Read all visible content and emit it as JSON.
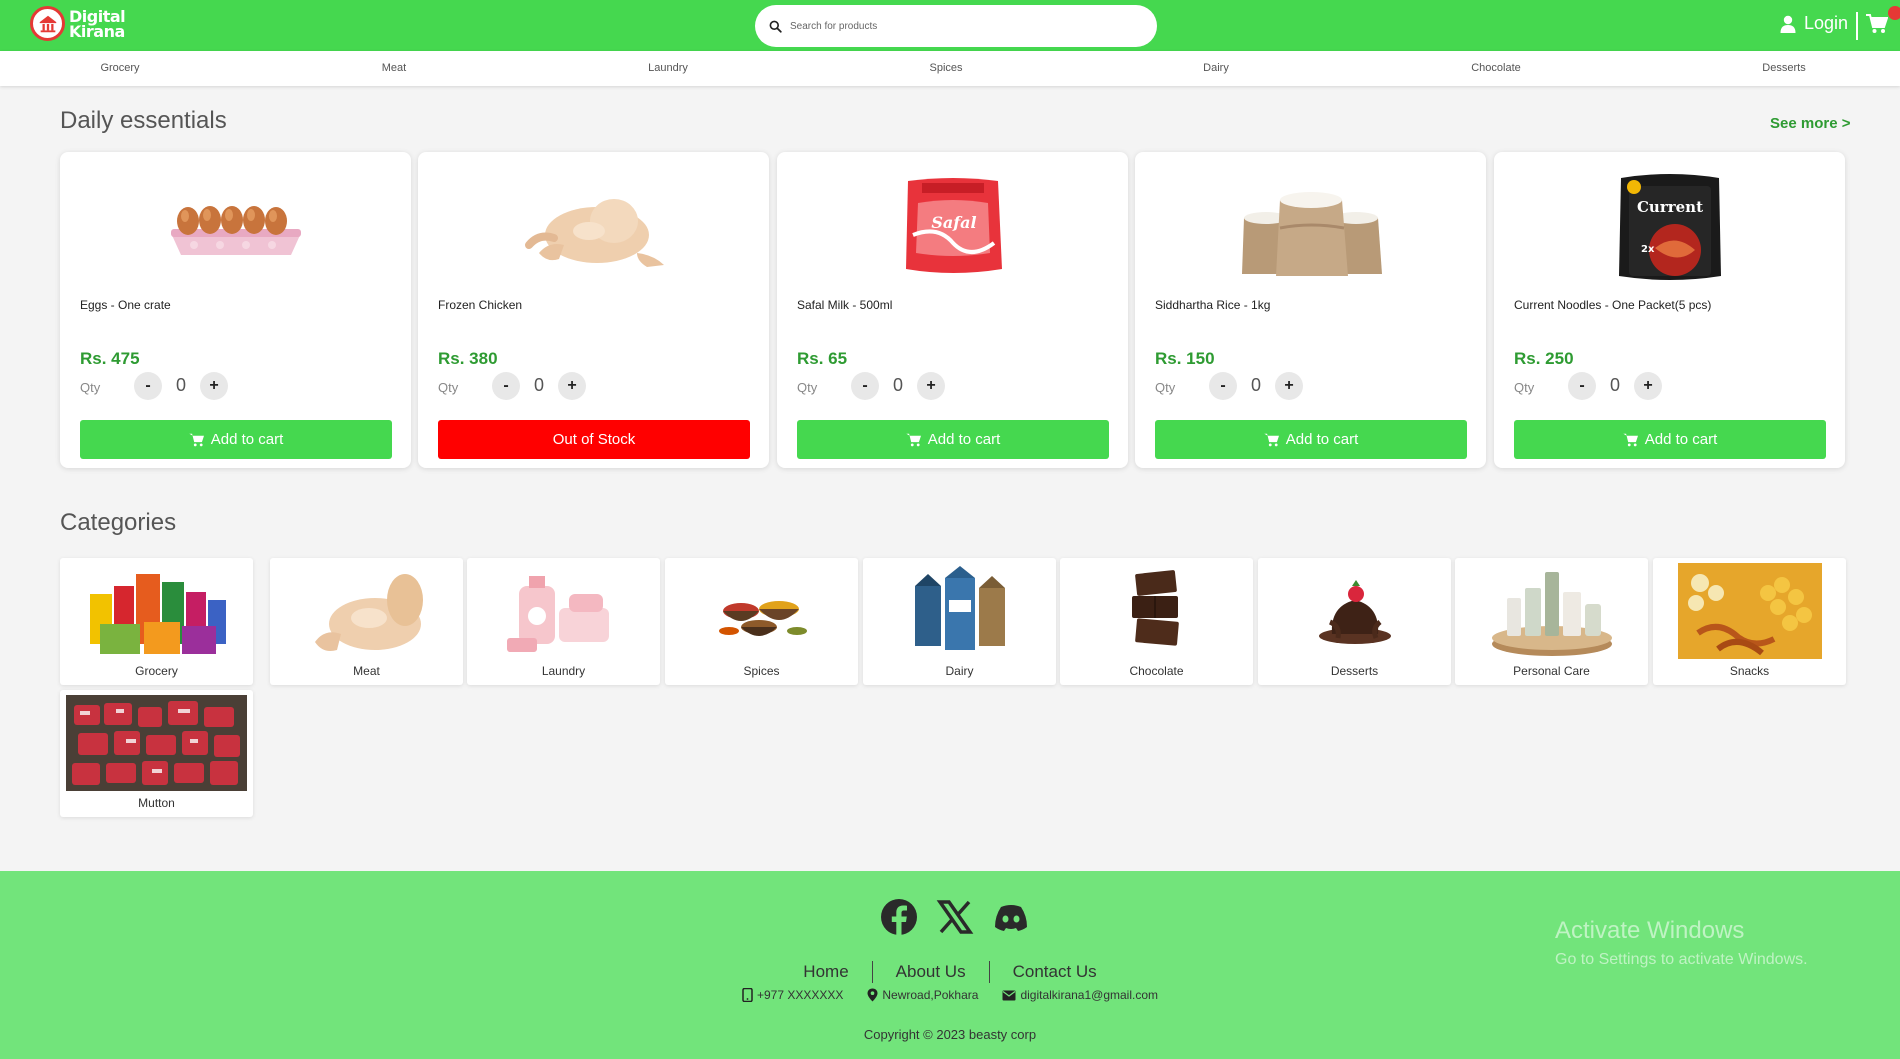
{
  "header": {
    "logo_line1": "Digital",
    "logo_line2": "Kirana",
    "search_placeholder": "Search for products",
    "login_label": "Login",
    "brand_color": "#45d84f"
  },
  "nav": [
    "Grocery",
    "Meat",
    "Laundry",
    "Spices",
    "Dairy",
    "Chocolate",
    "Desserts"
  ],
  "daily": {
    "title": "Daily essentials",
    "see_more": "See more >",
    "products": [
      {
        "name": "Eggs - One crate",
        "price": "Rs. 475",
        "qty_label": "Qty",
        "qty": "0",
        "button": "Add to cart",
        "in_stock": true,
        "image": "eggs"
      },
      {
        "name": "Frozen Chicken",
        "price": "Rs. 380",
        "qty_label": "Qty",
        "qty": "0",
        "button": "Out of Stock",
        "in_stock": false,
        "image": "chicken"
      },
      {
        "name": "Safal Milk - 500ml",
        "price": "Rs. 65",
        "qty_label": "Qty",
        "qty": "0",
        "button": "Add to cart",
        "in_stock": true,
        "image": "milk"
      },
      {
        "name": "Siddhartha Rice - 1kg",
        "price": "Rs. 150",
        "qty_label": "Qty",
        "qty": "0",
        "button": "Add to cart",
        "in_stock": true,
        "image": "rice"
      },
      {
        "name": "Current Noodles - One Packet(5 pcs)",
        "price": "Rs. 250",
        "qty_label": "Qty",
        "qty": "0",
        "button": "Add to cart",
        "in_stock": true,
        "image": "noodles"
      }
    ]
  },
  "categories": {
    "title": "Categories",
    "items": [
      "Grocery",
      "Meat",
      "Laundry",
      "Spices",
      "Dairy",
      "Chocolate",
      "Desserts",
      "Personal Care",
      "Snacks",
      "Mutton"
    ]
  },
  "footer": {
    "links": [
      "Home",
      "About Us",
      "Contact Us"
    ],
    "phone": "+977 XXXXXXX",
    "address": "Newroad,Pokhara",
    "email": "digitalkirana1@gmail.com",
    "copyright": "Copyright © 2023 beasty corp",
    "socials": [
      "facebook-icon",
      "x-icon",
      "discord-icon"
    ]
  },
  "watermark": {
    "line1": "Activate Windows",
    "line2": "Go to Settings to activate Windows."
  }
}
